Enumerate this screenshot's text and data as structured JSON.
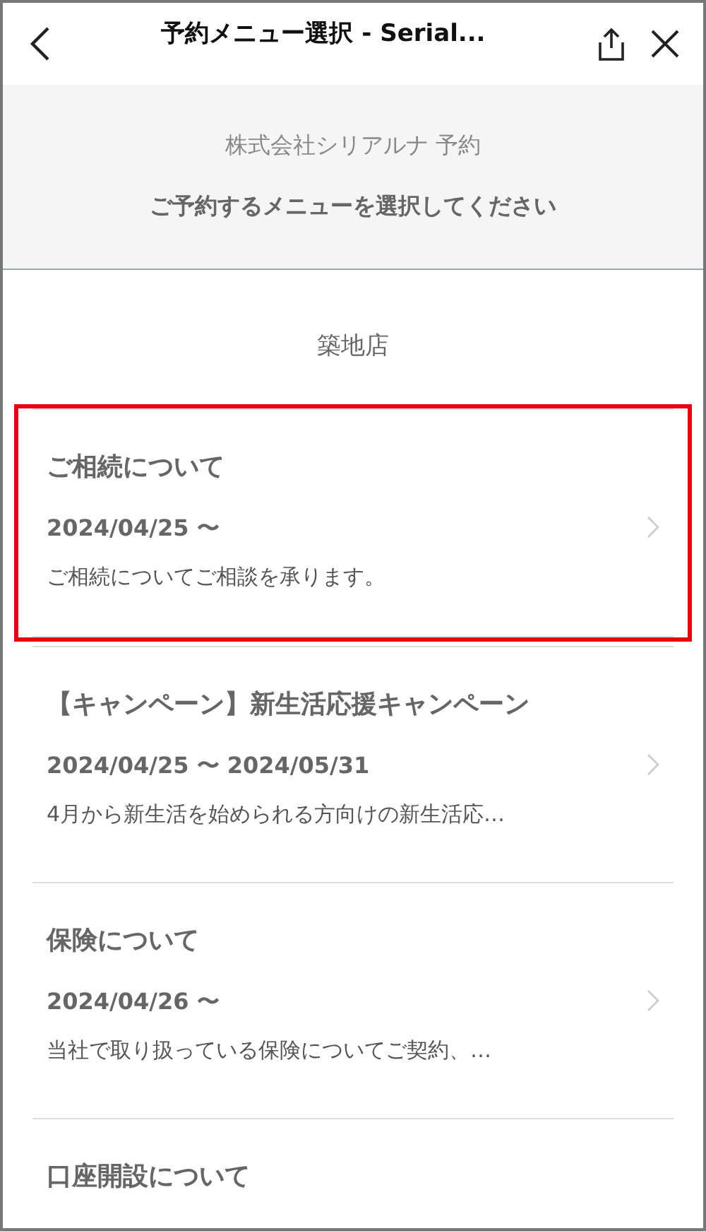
{
  "header": {
    "title": "予約メニュー選択 - Serial..."
  },
  "banner": {
    "company": "株式会社シリアルナ 予約",
    "instruction": "ご予約するメニューを選択してください"
  },
  "store": {
    "name": "築地店"
  },
  "menus": [
    {
      "title": "ご相続について",
      "date": "2024/04/25 〜",
      "description": "ご相続についてご相談を承ります。",
      "highlighted": true
    },
    {
      "title": "【キャンペーン】新生活応援キャンペーン",
      "date": "2024/04/25 〜 2024/05/31",
      "description": "4月から新生活を始められる方向けの新生活応…",
      "highlighted": false
    },
    {
      "title": "保険について",
      "date": "2024/04/26 〜",
      "description": "当社で取り扱っている保険についてご契約、…",
      "highlighted": false
    },
    {
      "title": "口座開設について",
      "highlighted": false
    }
  ]
}
